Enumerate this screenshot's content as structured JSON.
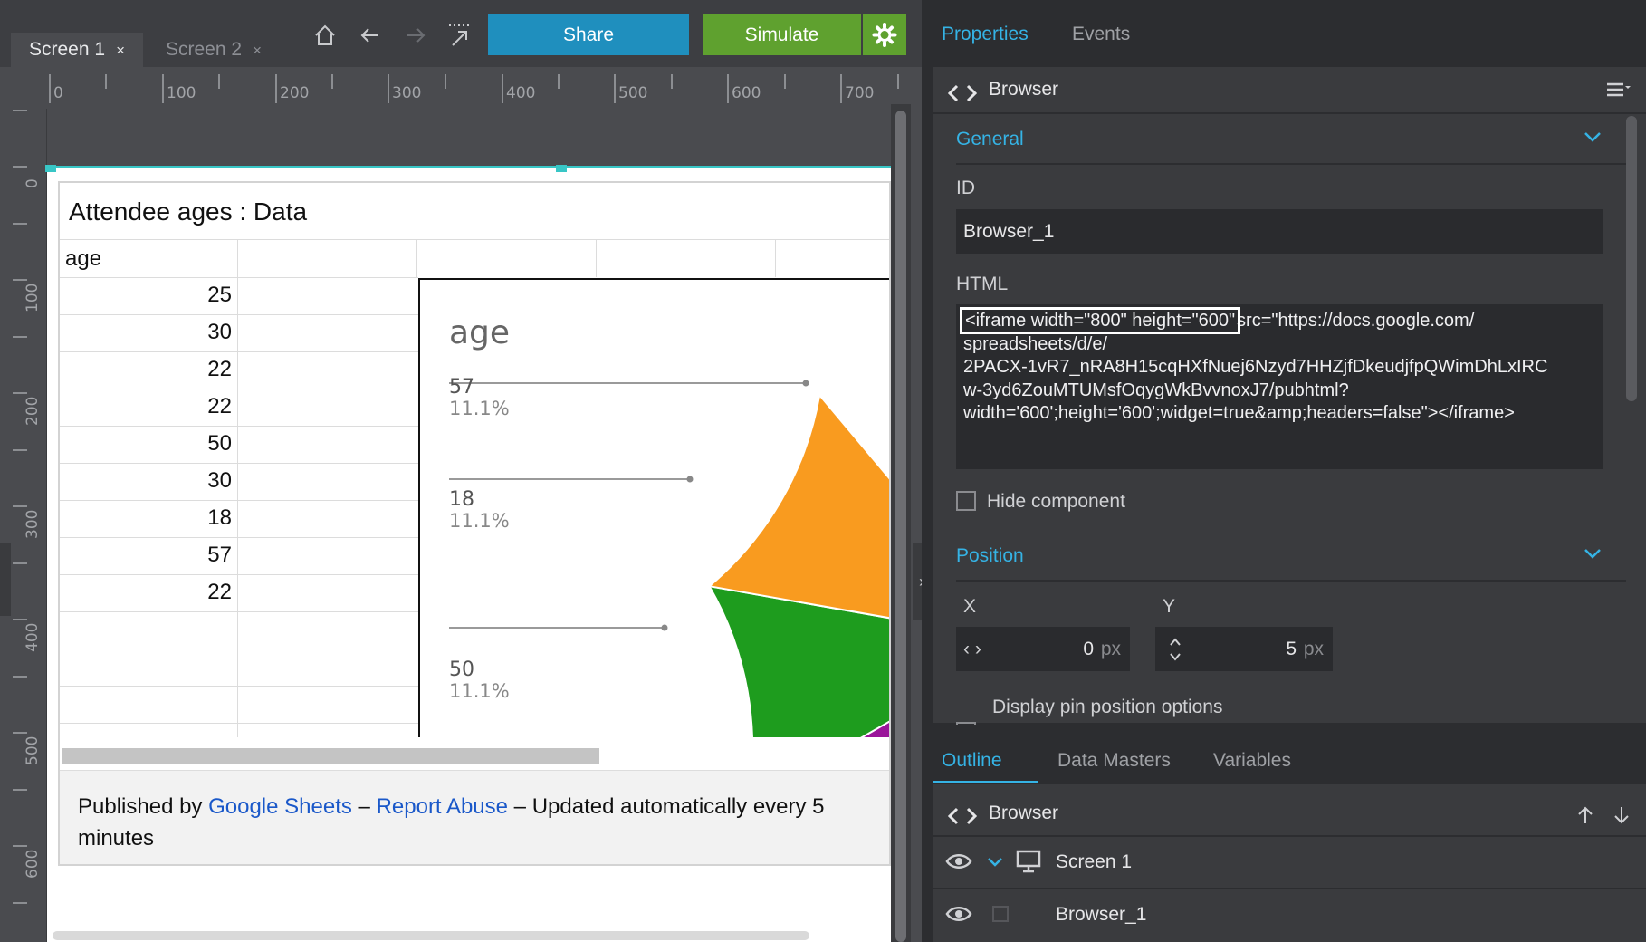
{
  "editor": {
    "tabs": [
      {
        "label": "Screen 1",
        "close": "×"
      },
      {
        "label": "Screen 2",
        "close": "×"
      }
    ],
    "share_label": "Share",
    "simulate_label": "Simulate",
    "ruler_h": [
      "0",
      "100",
      "200",
      "300",
      "400",
      "500",
      "600",
      "700"
    ],
    "ruler_v": [
      "0",
      "100",
      "200",
      "300",
      "400",
      "500",
      "600"
    ]
  },
  "iframe": {
    "sheet_title": "Attendee ages : Data",
    "column_header": "age",
    "ages": [
      "25",
      "30",
      "22",
      "22",
      "50",
      "30",
      "18",
      "57",
      "22"
    ],
    "chart": {
      "title": "age",
      "labels": [
        {
          "value": "57",
          "pct": "11.1%"
        },
        {
          "value": "18",
          "pct": "11.1%"
        },
        {
          "value": "50",
          "pct": "11.1%"
        }
      ]
    },
    "footer": {
      "prefix": "Published by ",
      "link1": "Google Sheets",
      "dash1": " – ",
      "link2": "Report Abuse",
      "dash2": " – ",
      "suffix": "Updated automatically every 5 minutes"
    }
  },
  "chart_data": {
    "type": "pie",
    "title": "age",
    "categories": [
      "57",
      "18",
      "50"
    ],
    "values": [
      11.1,
      11.1,
      11.1
    ],
    "colors": [
      "#1b9ad2",
      "#9a169a",
      "#1e9c1e",
      "#f99b1f"
    ]
  },
  "properties": {
    "tab_properties": "Properties",
    "tab_events": "Events",
    "component_name": "Browser",
    "section_general": "General",
    "id_label": "ID",
    "id_value": "Browser_1",
    "html_label": "HTML",
    "html_highlight": "<iframe width=\"800\" height=\"600\"",
    "html_rest_1": "src=\"https://docs.google.com/",
    "html_rest_2": "spreadsheets/d/e/",
    "html_rest_3": "2PACX-1vR7_nRA8H15cqHXfNuej6Nzyd7HHZjfDkeudjfpQWimDhLxIRC",
    "html_rest_4": "w-3yd6ZouMTUMsfOqygWkBvvnoxJ7/pubhtml?",
    "html_rest_5": "width='600';height='600';widget=true&amp;headers=false\"></iframe>",
    "hide_component": "Hide component",
    "section_position": "Position",
    "x_label": "X",
    "x_value": "0",
    "y_label": "Y",
    "y_value": "5",
    "unit": "px",
    "pin_options": "Display pin position options"
  },
  "outline": {
    "tabs": [
      "Outline",
      "Data Masters",
      "Variables"
    ],
    "header_name": "Browser",
    "rows": [
      {
        "label": "Screen 1"
      },
      {
        "label": "Browser_1"
      }
    ]
  },
  "colors": {
    "accent": "#35b3e5",
    "share": "#1f8fbe",
    "simulate": "#5fa12f",
    "selection": "#38c6c6"
  }
}
